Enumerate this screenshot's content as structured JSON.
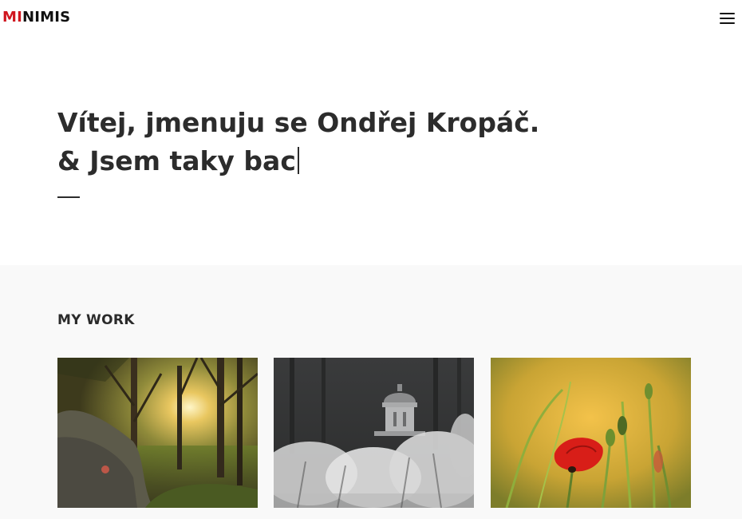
{
  "header": {
    "logo_accent": "MI",
    "logo_rest": "NIMIS",
    "menu_icon": "hamburger-menu-icon"
  },
  "hero": {
    "line1": "Vítej, jmenuju se Ondřej Kropáč.",
    "line2": "& Jsem taky bac"
  },
  "work": {
    "title": "MY WORK",
    "items": [
      {
        "image": "forest-sunset-rocks-photo"
      },
      {
        "image": "misty-domed-mausoleum-photo"
      },
      {
        "image": "red-poppy-meadow-photo"
      }
    ]
  },
  "colors": {
    "accent": "#d0161f",
    "text": "#2c2c2c",
    "section_bg": "#f9f9f9"
  }
}
